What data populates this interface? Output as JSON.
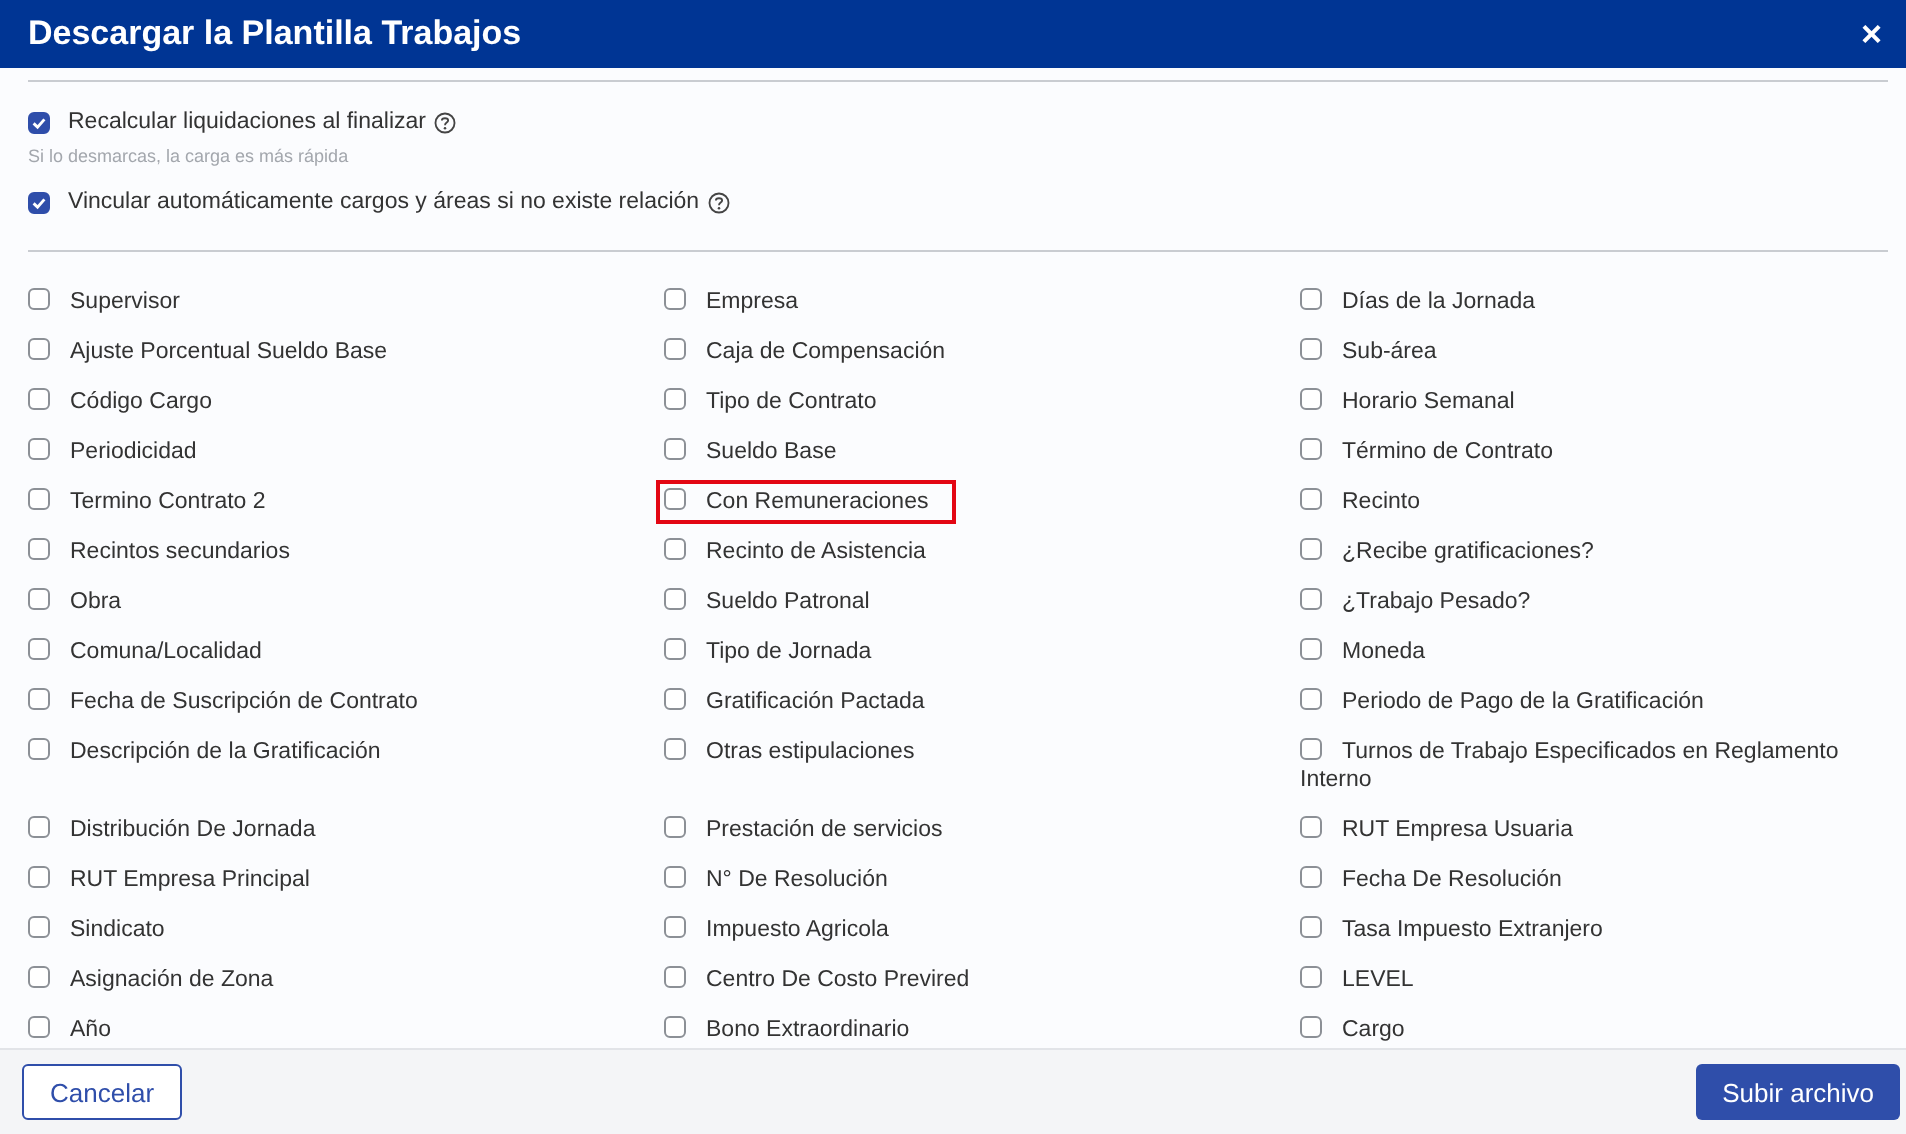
{
  "window": {
    "title": "Descargar la Plantilla Trabajos",
    "close": "×"
  },
  "options": [
    {
      "label": "Recalcular liquidaciones al finalizar",
      "checked": true,
      "help": true,
      "hint": "Si lo desmarcas, la carga es más rápida"
    },
    {
      "label": "Vincular automáticamente cargos y áreas si no existe relación",
      "checked": true,
      "help": true
    }
  ],
  "fields": [
    {
      "label": "Supervisor",
      "checked": false,
      "highlighted": false
    },
    {
      "label": "Empresa",
      "checked": false,
      "highlighted": false
    },
    {
      "label": "Días de la Jornada",
      "checked": false,
      "highlighted": false
    },
    {
      "label": "Ajuste Porcentual Sueldo Base",
      "checked": false,
      "highlighted": false
    },
    {
      "label": "Caja de Compensación",
      "checked": false,
      "highlighted": false
    },
    {
      "label": "Sub-área",
      "checked": false,
      "highlighted": false
    },
    {
      "label": "Código Cargo",
      "checked": false,
      "highlighted": false
    },
    {
      "label": "Tipo de Contrato",
      "checked": false,
      "highlighted": false
    },
    {
      "label": "Horario Semanal",
      "checked": false,
      "highlighted": false
    },
    {
      "label": "Periodicidad",
      "checked": false,
      "highlighted": false
    },
    {
      "label": "Sueldo Base",
      "checked": false,
      "highlighted": false
    },
    {
      "label": "Término de Contrato",
      "checked": false,
      "highlighted": false
    },
    {
      "label": "Termino Contrato 2",
      "checked": false,
      "highlighted": false
    },
    {
      "label": "Con Remuneraciones",
      "checked": false,
      "highlighted": true
    },
    {
      "label": "Recinto",
      "checked": false,
      "highlighted": false
    },
    {
      "label": "Recintos secundarios",
      "checked": false,
      "highlighted": false
    },
    {
      "label": "Recinto de Asistencia",
      "checked": false,
      "highlighted": false
    },
    {
      "label": "¿Recibe gratificaciones?",
      "checked": false,
      "highlighted": false
    },
    {
      "label": "Obra",
      "checked": false,
      "highlighted": false
    },
    {
      "label": "Sueldo Patronal",
      "checked": false,
      "highlighted": false
    },
    {
      "label": "¿Trabajo Pesado?",
      "checked": false,
      "highlighted": false
    },
    {
      "label": "Comuna/Localidad",
      "checked": false,
      "highlighted": false
    },
    {
      "label": "Tipo de Jornada",
      "checked": false,
      "highlighted": false
    },
    {
      "label": "Moneda",
      "checked": false,
      "highlighted": false
    },
    {
      "label": "Fecha de Suscripción de Contrato",
      "checked": false,
      "highlighted": false
    },
    {
      "label": "Gratificación Pactada",
      "checked": false,
      "highlighted": false
    },
    {
      "label": "Periodo de Pago de la Gratificación",
      "checked": false,
      "highlighted": false
    },
    {
      "label": "Descripción de la Gratificación",
      "checked": false,
      "highlighted": false
    },
    {
      "label": "Otras estipulaciones",
      "checked": false,
      "highlighted": false
    },
    {
      "label": "Turnos de Trabajo Especificados en Reglamento Interno",
      "checked": false,
      "highlighted": false
    },
    {
      "label": "Distribución De Jornada",
      "checked": false,
      "highlighted": false
    },
    {
      "label": "Prestación de servicios",
      "checked": false,
      "highlighted": false
    },
    {
      "label": "RUT Empresa Usuaria",
      "checked": false,
      "highlighted": false
    },
    {
      "label": "RUT Empresa Principal",
      "checked": false,
      "highlighted": false
    },
    {
      "label": "N° De Resolución",
      "checked": false,
      "highlighted": false
    },
    {
      "label": "Fecha De Resolución",
      "checked": false,
      "highlighted": false
    },
    {
      "label": "Sindicato",
      "checked": false,
      "highlighted": false
    },
    {
      "label": "Impuesto Agricola",
      "checked": false,
      "highlighted": false
    },
    {
      "label": "Tasa Impuesto Extranjero",
      "checked": false,
      "highlighted": false
    },
    {
      "label": "Asignación de Zona",
      "checked": false,
      "highlighted": false
    },
    {
      "label": "Centro De Costo Previred",
      "checked": false,
      "highlighted": false
    },
    {
      "label": "LEVEL",
      "checked": false,
      "highlighted": false
    },
    {
      "label": "Año",
      "checked": false,
      "highlighted": false
    },
    {
      "label": "Bono Extraordinario",
      "checked": false,
      "highlighted": false
    },
    {
      "label": "Cargo",
      "checked": false,
      "highlighted": false
    }
  ],
  "buttons": {
    "cancel": "Cancelar",
    "submit": "Subir archivo"
  }
}
